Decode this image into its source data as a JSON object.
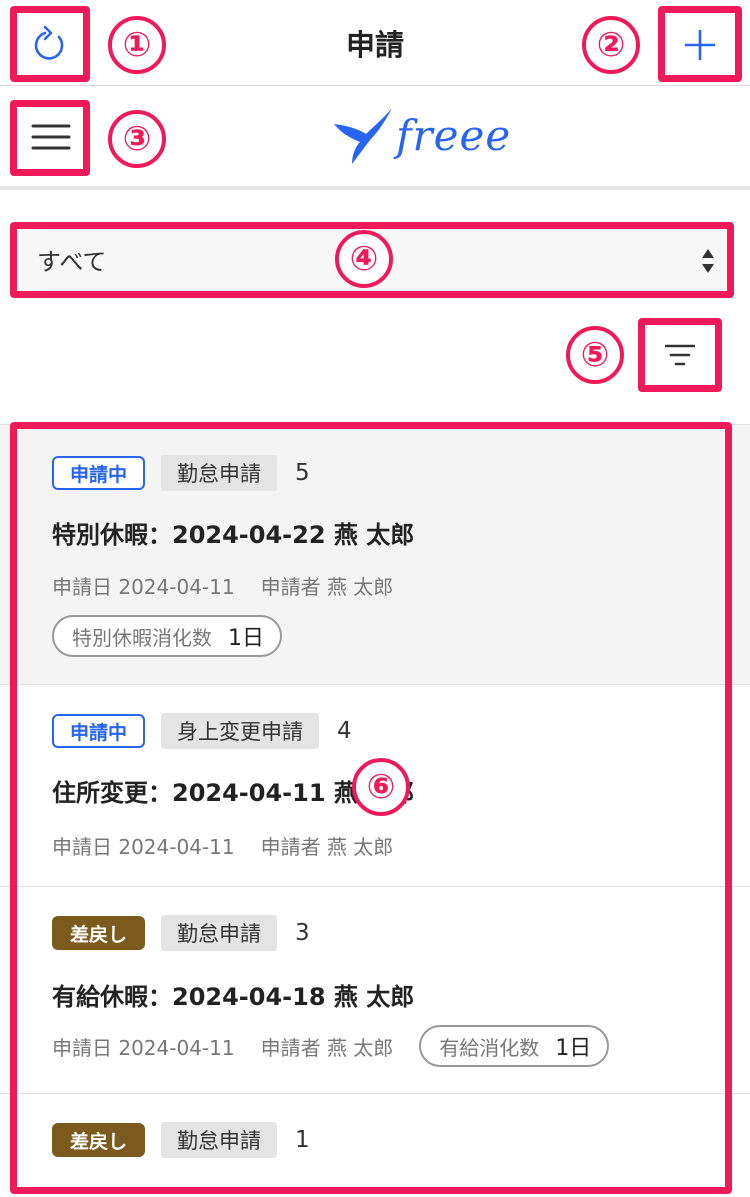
{
  "header": {
    "title": "申請"
  },
  "brand": {
    "logo_text": "freee"
  },
  "filter": {
    "selected": "すべて"
  },
  "requests": [
    {
      "status": "申請中",
      "status_kind": "pending",
      "type": "勤怠申請",
      "number": "5",
      "title": "特別休暇：2024-04-22 燕 太郎",
      "applied_date": "申請日 2024-04-11",
      "applicant": "申請者 燕 太郎",
      "pill_label": "特別休暇消化数",
      "pill_value": "1日"
    },
    {
      "status": "申請中",
      "status_kind": "pending",
      "type": "身上変更申請",
      "number": "4",
      "title": "住所変更：2024-04-11 燕 太郎",
      "applied_date": "申請日 2024-04-11",
      "applicant": "申請者 燕 太郎"
    },
    {
      "status": "差戻し",
      "status_kind": "returned",
      "type": "勤怠申請",
      "number": "3",
      "title": "有給休暇：2024-04-18 燕 太郎",
      "applied_date": "申請日 2024-04-11",
      "applicant": "申請者 燕 太郎",
      "pill_label": "有給消化数",
      "pill_value": "1日"
    },
    {
      "status": "差戻し",
      "status_kind": "returned",
      "type": "勤怠申請",
      "number": "1"
    }
  ],
  "annotations": [
    "①",
    "②",
    "③",
    "④",
    "⑤",
    "⑥"
  ],
  "colors": {
    "accent": "#2864f0",
    "annotation": "#f0195a",
    "returned": "#7c5a1e"
  }
}
